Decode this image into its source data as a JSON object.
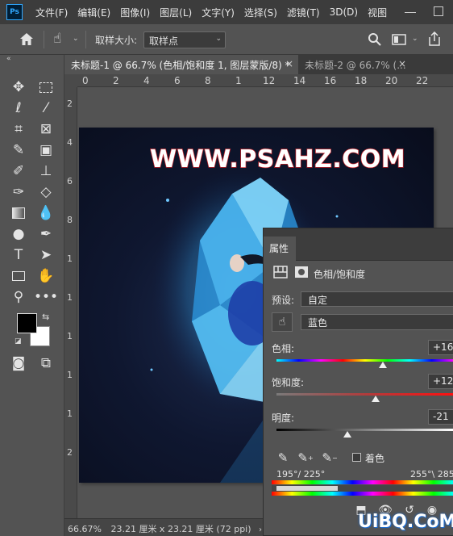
{
  "app": {
    "logo_text": "Ps"
  },
  "menu": [
    "文件(F)",
    "编辑(E)",
    "图像(I)",
    "图层(L)",
    "文字(Y)",
    "选择(S)",
    "滤镜(T)",
    "3D(D)",
    "视图"
  ],
  "options_bar": {
    "sample_size_label": "取样大小:",
    "sample_size_value": "取样点"
  },
  "tabs": [
    {
      "label": "未标题-1 @ 66.7% (色相/饱和度 1, 图层蒙版/8) *",
      "active": true
    },
    {
      "label": "未标题-2 @ 66.7% (...",
      "active": false
    }
  ],
  "ruler_h": [
    "0",
    "2",
    "4",
    "6",
    "8",
    "1",
    "12",
    "14",
    "16",
    "18",
    "20",
    "22"
  ],
  "ruler_v": [
    "2",
    "4",
    "6",
    "8",
    "1",
    "1",
    "1",
    "1",
    "1",
    "2"
  ],
  "canvas": {
    "watermark": "WWW.PSAHZ.COM"
  },
  "status": {
    "zoom": "66.67%",
    "doc_size": "23.21 厘米 x 23.21 厘米 (72 ppi)"
  },
  "properties": {
    "title": "属性",
    "adjustment_name": "色相/饱和度",
    "preset_label": "预设:",
    "preset_value": "自定",
    "channel_value": "蓝色",
    "hue_label": "色相:",
    "hue_value": "+16",
    "hue_level": 0.6,
    "saturation_label": "饱和度:",
    "saturation_value": "+12",
    "saturation_level": 0.56,
    "lightness_label": "明度:",
    "lightness_value": "-21",
    "lightness_level": 0.4,
    "colorize_label": "着色",
    "range_left": "195°/ 225°",
    "range_right": "255°\\ 285"
  },
  "site_watermark": "UiBQ.CoM"
}
